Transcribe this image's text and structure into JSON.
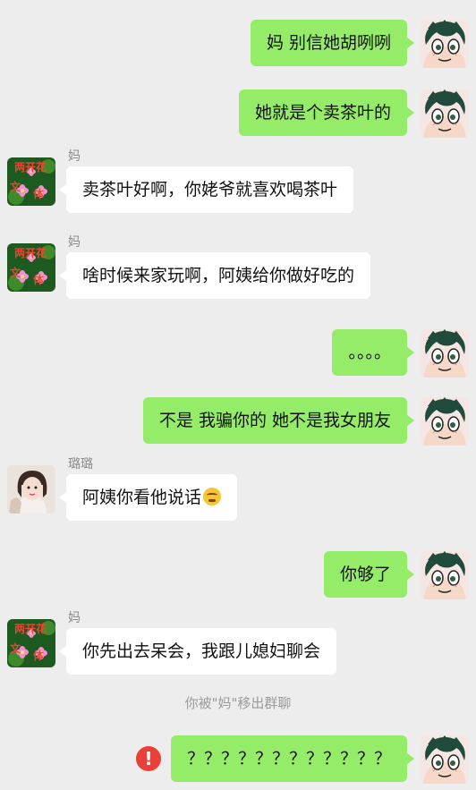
{
  "contacts": {
    "mom": "妈",
    "lulu": "璐璐"
  },
  "avatars": {
    "mom_text_top": "两开花",
    "mom_text_left": "文",
    "mom_text_right": "体"
  },
  "messages": [
    {
      "from": "me",
      "text": "妈 别信她胡咧咧"
    },
    {
      "from": "me",
      "text": "她就是个卖茶叶的"
    },
    {
      "from": "mom",
      "sender": "妈",
      "text": "卖茶叶好啊，你姥爷就喜欢喝茶叶"
    },
    {
      "from": "mom",
      "sender": "妈",
      "text": "啥时候来家玩啊，阿姨给你做好吃的"
    },
    {
      "from": "me",
      "text": "。。。。"
    },
    {
      "from": "me",
      "text": "不是 我骗你的 她不是我女朋友"
    },
    {
      "from": "lulu",
      "sender": "璐璐",
      "text": "阿姨你看他说话",
      "emoji": "grimace-emoji"
    },
    {
      "from": "me",
      "text": "你够了"
    },
    {
      "from": "mom",
      "sender": "妈",
      "text": "你先出去呆会，我跟儿媳妇聊会"
    },
    {
      "from": "me",
      "text": "？？？？？？？？？？？？",
      "failed": true
    }
  ],
  "system_notice": "你被\"妈\"移出群聊",
  "error_mark": "!",
  "colors": {
    "background": "#ededed",
    "my_bubble": "#95ec69",
    "their_bubble": "#ffffff",
    "error": "#e9403a",
    "name_gray": "#8a8a8a"
  }
}
